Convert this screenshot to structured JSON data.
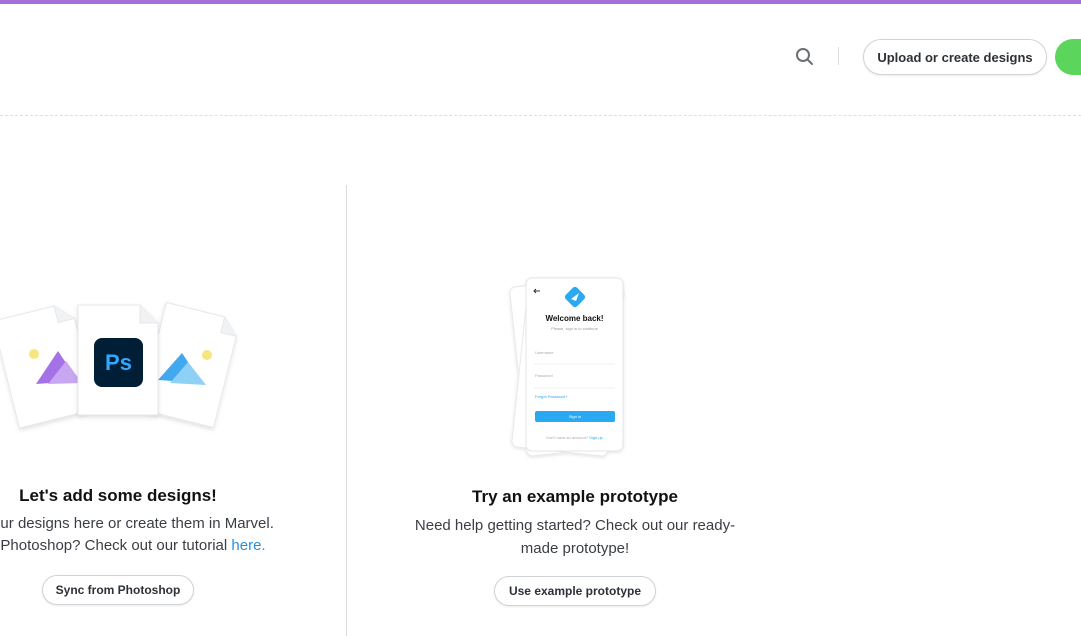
{
  "header": {
    "upload_label": "Upload or create designs"
  },
  "left_panel": {
    "title": "Let's add some designs!",
    "desc_line1": "our designs here or create them in Marvel.",
    "desc_line2_prefix": "Photoshop? Check out our tutorial ",
    "desc_link": "here.",
    "sync_button": "Sync from Photoshop",
    "ps_logo_text": "Ps"
  },
  "right_panel": {
    "title": "Try an example prototype",
    "desc_line1": "Need help getting started? Check out our ready-",
    "desc_line2": "made prototype!",
    "button": "Use example prototype",
    "phone": {
      "heading": "Welcome back!",
      "subheading": "Please, sign in to continue",
      "username_label": "Username",
      "password_label": "Password",
      "forgot_link": "Forgot Password?",
      "signin_button": "Sign in",
      "footer_prefix": "Don't have an account?",
      "footer_link": "Sign up"
    }
  },
  "colors": {
    "accent_bar": "#a56ed9",
    "green_button": "#5bd55b",
    "link_blue": "#2d8dd8",
    "phone_blue": "#29a9f2",
    "ps_dark": "#001e36",
    "ps_blue": "#31a8ff"
  },
  "icons": {
    "search": "search-icon",
    "back_arrow": "back-arrow-icon",
    "marvel_logo": "marvel-logo-icon"
  }
}
